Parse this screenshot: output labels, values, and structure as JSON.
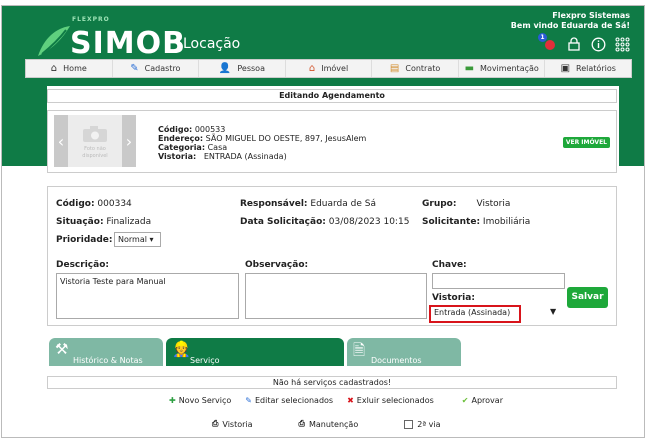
{
  "header": {
    "brand_small": "FLEXPRO",
    "brand": "SIMOB",
    "module": "Locação",
    "company": "Flexpro Sistemas",
    "welcome": "Bem vindo Eduarda de Sá!",
    "notification_count": "1"
  },
  "nav": [
    {
      "label": "Home",
      "icon": "home-icon"
    },
    {
      "label": "Cadastro",
      "icon": "pencil-icon"
    },
    {
      "label": "Pessoa",
      "icon": "person-icon"
    },
    {
      "label": "Imóvel",
      "icon": "house-icon"
    },
    {
      "label": "Contrato",
      "icon": "document-icon"
    },
    {
      "label": "Movimentação",
      "icon": "money-icon"
    },
    {
      "label": "Relatórios",
      "icon": "report-icon"
    }
  ],
  "page_title": "Editando Agendamento",
  "property": {
    "photo_text": "Foto não disponível",
    "codigo_label": "Código:",
    "codigo": "000533",
    "endereco_label": "Endereço:",
    "endereco": "SÃO MIGUEL DO OESTE, 897, JesusAlem",
    "categoria_label": "Categoria:",
    "categoria": "Casa",
    "vistoria_label": "Vistoria:",
    "vistoria": "ENTRADA (Assinada)",
    "ver_imovel": "VER IMÓVEL"
  },
  "detail": {
    "codigo_label": "Código:",
    "codigo": "000334",
    "responsavel_label": "Responsável:",
    "responsavel": "Eduarda de Sá",
    "grupo_label": "Grupo:",
    "grupo": "Vistoria",
    "situacao_label": "Situação:",
    "situacao": "Finalizada",
    "data_label": "Data Solicitação:",
    "data": "03/08/2023 10:15",
    "solicitante_label": "Solicitante:",
    "solicitante": "Imobiliária",
    "prioridade_label": "Prioridade:",
    "prioridade": "Normal",
    "descricao_label": "Descrição:",
    "descricao": "Vistoria Teste para Manual",
    "observacao_label": "Observação:",
    "observacao": "",
    "chave_label": "Chave:",
    "chave": "",
    "vistoria_label": "Vistoria:",
    "vistoria": "Entrada (Assinada)",
    "salvar": "Salvar"
  },
  "tabs": [
    {
      "label": "Histórico & Notas",
      "color": "#7fb8a4"
    },
    {
      "label": "Serviço",
      "color": "#0f7b46"
    },
    {
      "label": "Documentos",
      "color": "#7fb8a4"
    }
  ],
  "no_services": "Não há serviços cadastrados!",
  "actions": {
    "novo": "Novo Serviço",
    "editar": "Editar selecionados",
    "excluir": "Exluir selecionados",
    "aprovar": "Aprovar"
  },
  "bottom": {
    "vistoria": "Vistoria",
    "manutencao": "Manutenção",
    "segunda_via": "2ª via"
  },
  "colors": {
    "brand_green": "#0f7b46",
    "button_green": "#1ea83a",
    "highlight_red": "#d8141b"
  }
}
